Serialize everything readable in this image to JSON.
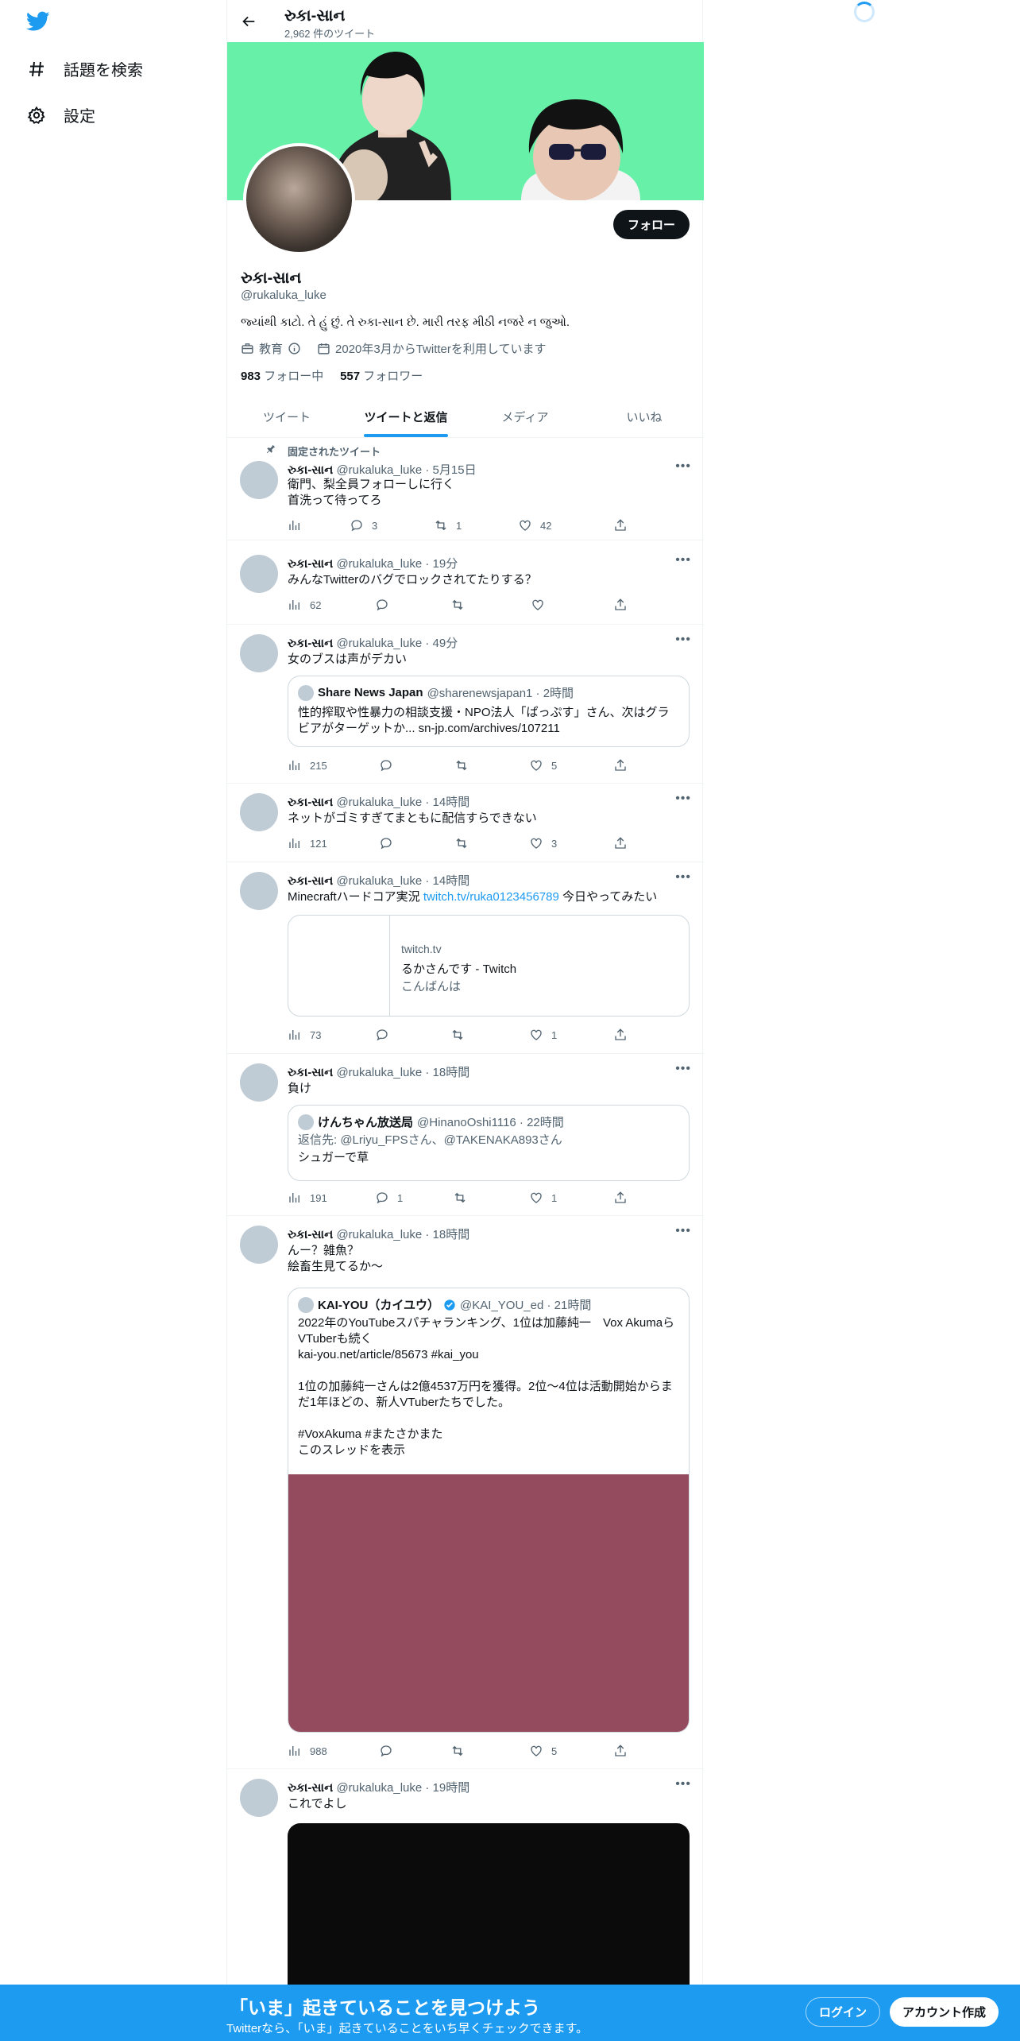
{
  "nav": {
    "explore_label": "話題を検索",
    "settings_label": "設定"
  },
  "header": {
    "name": "રુકા-સાન",
    "tweet_count": "2,962 件のツイート"
  },
  "profile": {
    "follow_label": "フォロー",
    "name": "રુકા-સાન",
    "handle": "@rukaluka_luke",
    "bio": "જ્યાંથી કાટો. તે હું છું. તે રુકા-સાન છે. મારી તરફ મીઠી નજરે ન જુઓ.",
    "category": "教育",
    "joined": "2020年3月からTwitterを利用しています",
    "following_count": "983",
    "following_label": "フォロー中",
    "followers_count": "557",
    "followers_label": "フォロワー"
  },
  "tabs": [
    "ツイート",
    "ツイートと返信",
    "メディア",
    "いいね"
  ],
  "pinned_label": "固定されたツイート",
  "tweets": [
    {
      "name": "રુકા-સાન",
      "meta": "@rukaluka_luke · 5月15日",
      "text": "衛門、梨全員フォローしに行く\n首洗って待ってろ",
      "views": "",
      "replies": "3",
      "retweets": "1",
      "likes": "42"
    },
    {
      "name": "રુકા-સાન",
      "meta": "@rukaluka_luke · 19分",
      "text": "みんなTwitterのバグでロックされてたりする？",
      "views": "62",
      "replies": "",
      "retweets": "",
      "likes": ""
    },
    {
      "name": "રુકા-સાન",
      "meta": "@rukaluka_luke · 49分",
      "text": "女のブスは声がデカい",
      "views": "215",
      "replies": "",
      "retweets": "",
      "likes": "5",
      "quote": {
        "name": "Share News Japan",
        "meta": "@sharenewsjapan1 · 2時間",
        "text": "性的搾取や性暴力の相談支援・NPO法人「ぱっぷす」さん、次はグラビアがターゲットか... sn-jp.com/archives/107211"
      }
    },
    {
      "name": "રુકા-સાન",
      "meta": "@rukaluka_luke · 14時間",
      "text": "ネットがゴミすぎてまともに配信すらできない",
      "views": "121",
      "replies": "",
      "retweets": "",
      "likes": "3"
    },
    {
      "name": "રુકા-સાન",
      "meta": "@rukaluka_luke · 14時間",
      "text_pre": "Minecraftハードコア実況 ",
      "link": "twitch.tv/ruka0123456789",
      "text_post": " 今日やってみたい",
      "views": "73",
      "replies": "",
      "retweets": "",
      "likes": "1",
      "card": {
        "domain": "twitch.tv",
        "title": "るかさんです - Twitch",
        "desc": "こんばんは"
      }
    },
    {
      "name": "રુકા-સાન",
      "meta": "@rukaluka_luke · 18時間",
      "text": "負け",
      "views": "191",
      "replies": "1",
      "retweets": "",
      "likes": "1",
      "quote": {
        "name": "けんちゃん放送局",
        "meta": "@HinanoOshi1116 · 22時間",
        "reply_to": "返信先: @Lriyu_FPSさん、@TAKENAKA893さん",
        "text": "シュガーで草"
      }
    },
    {
      "name": "રુકા-સાન",
      "meta": "@rukaluka_luke · 18時間",
      "text": "んー？雑魚？\n絵畜生見てるか〜",
      "views": "988",
      "replies": "",
      "retweets": "",
      "likes": "5",
      "quote": {
        "name": "KAI-YOU（カイユウ）",
        "meta": "@KAI_YOU_ed · 21時間",
        "text": "2022年のYouTubeスパチャランキング、1位は加藤純一　Vox AkumaらVTuberも続く\nkai-you.net/article/85673 #kai_you\n\n1位の加藤純一さんは2億4537万円を獲得。2位～4位は活動開始からまだ1年ほどの、新人VTuberたちでした。\n\n#VoxAkuma #またさかまた",
        "thread_label": "このスレッドを表示"
      }
    },
    {
      "name": "રુકા-સાન",
      "meta": "@rukaluka_luke · 19時間",
      "text": "これでよし"
    }
  ],
  "bottom_bar": {
    "title": "「いま」起きていることを見つけよう",
    "subtitle": "Twitterなら、「いま」起きていることをいち早くチェックできます。",
    "login_label": "ログイン",
    "signup_label": "アカウント作成"
  },
  "colors": {
    "accent": "#1d9bf0",
    "banner": "#66f0a8",
    "media_placeholder": "#954b5e",
    "video_black": "#0b0b0b"
  }
}
